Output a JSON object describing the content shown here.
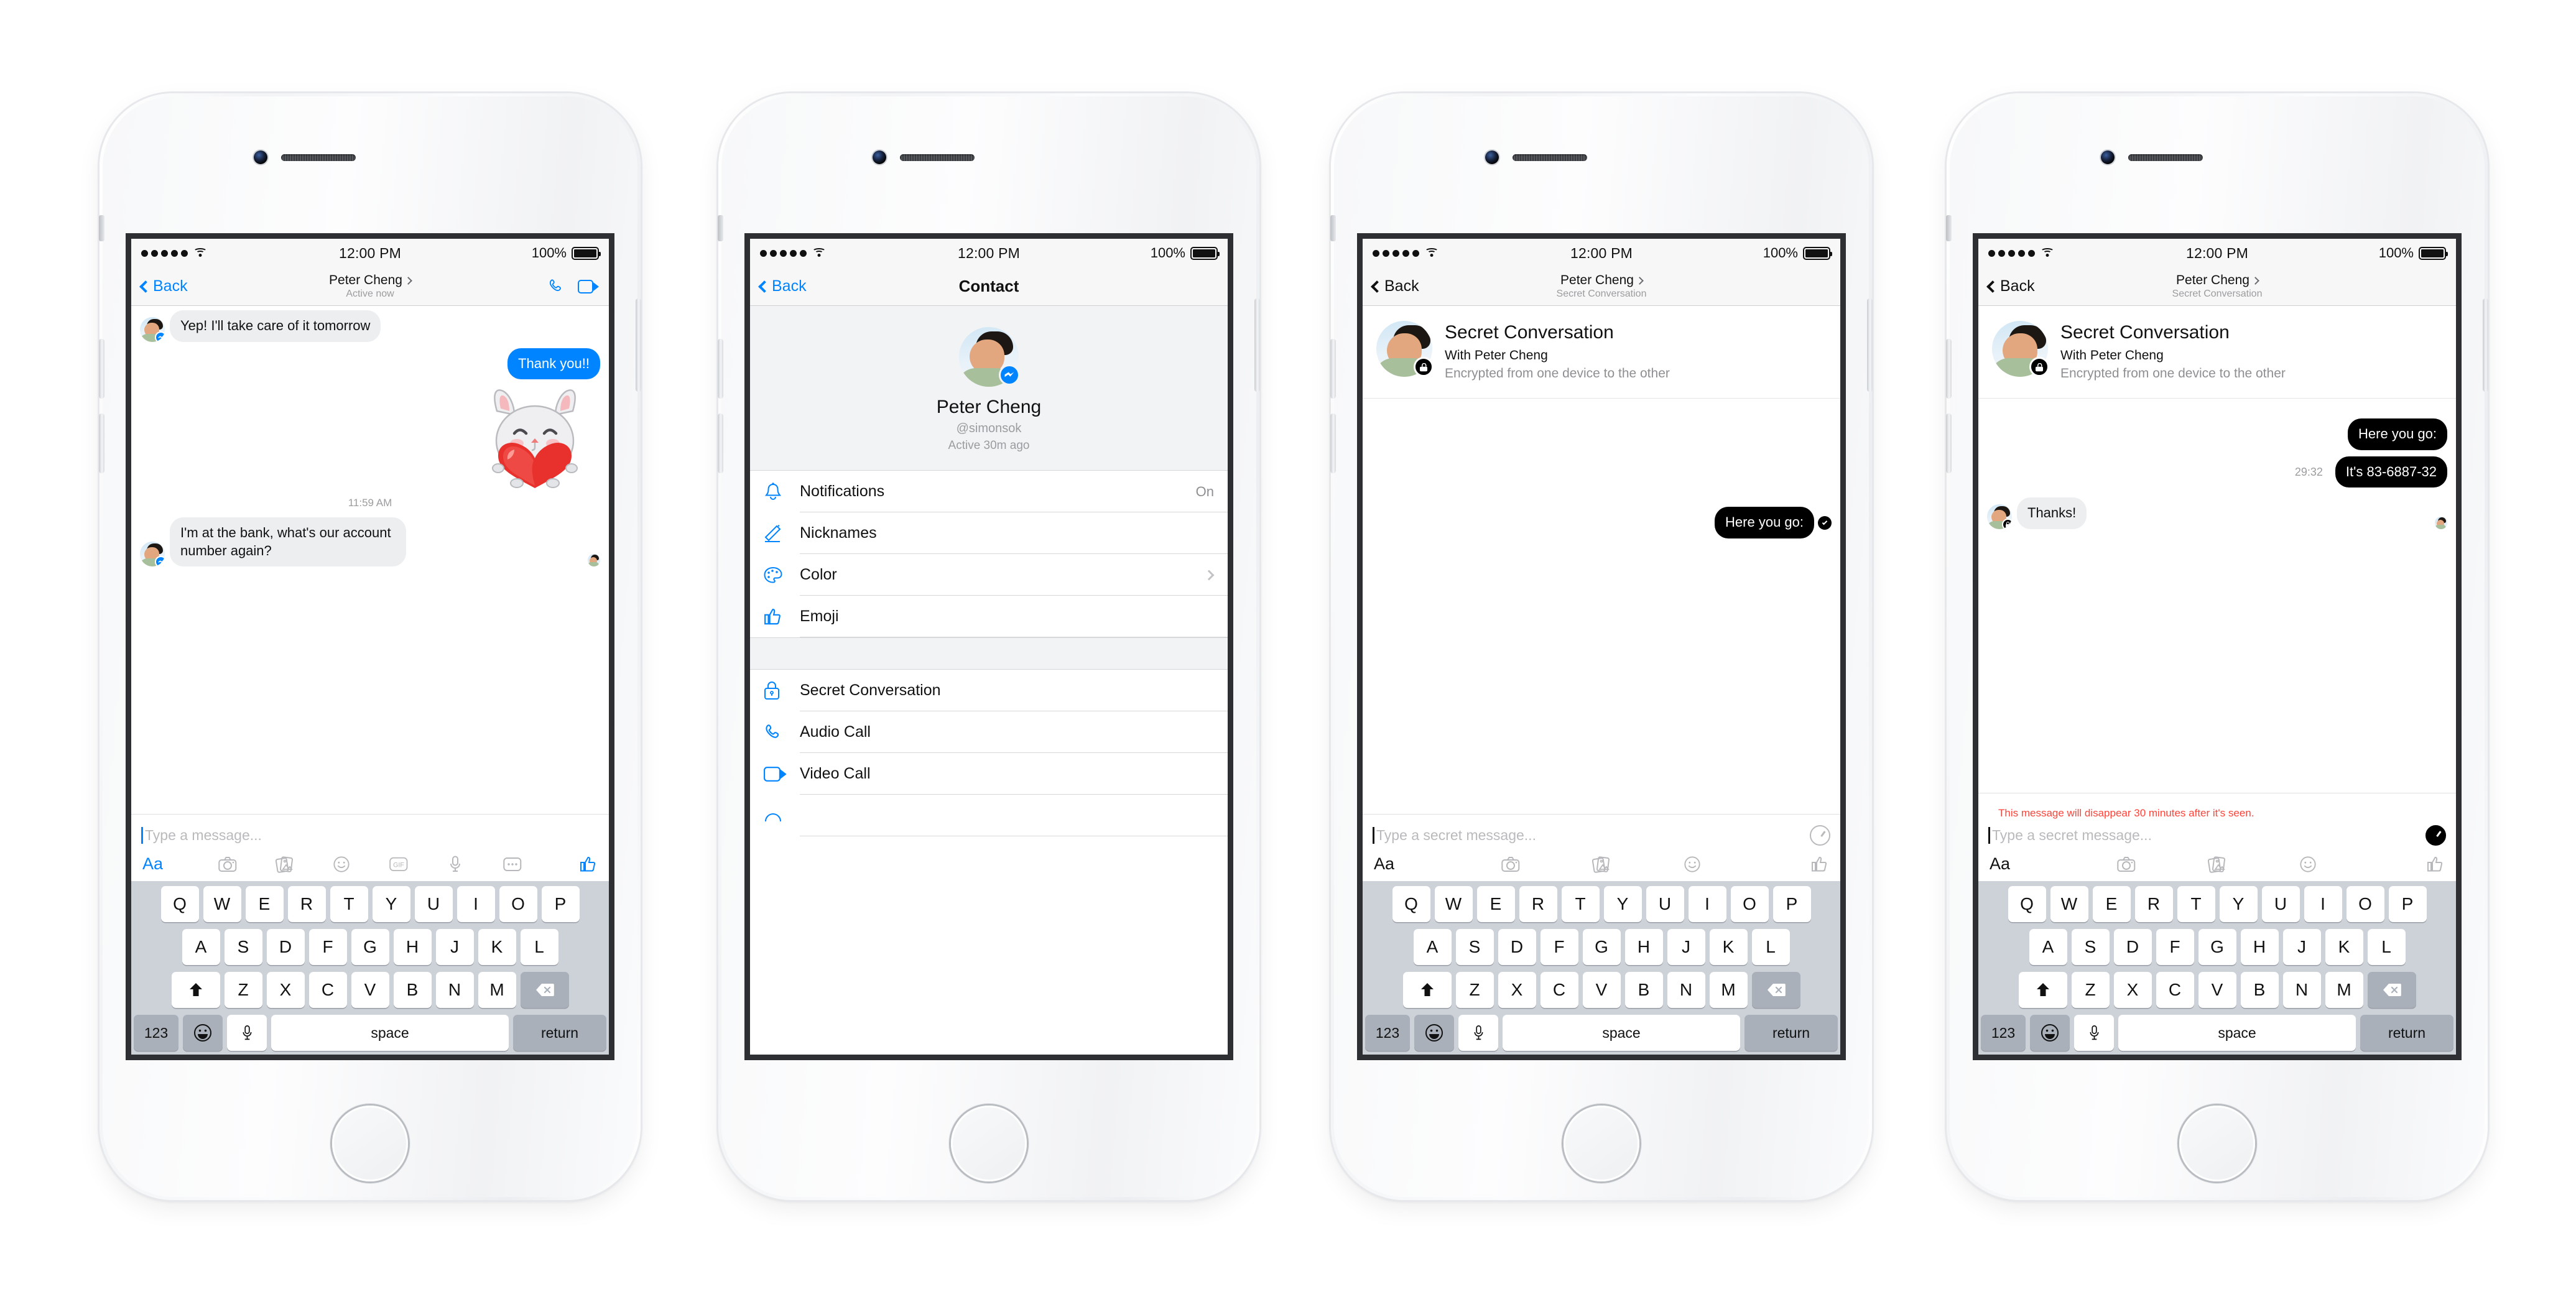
{
  "status_bar": {
    "time": "12:00 PM",
    "battery_pct": "100%",
    "signal_dots": 5
  },
  "colors": {
    "accent_blue": "#0084ff",
    "secret_black": "#000000",
    "warning_red": "#ff4338",
    "keyboard_bg": "#cdd2d9"
  },
  "keyboard": {
    "row1": [
      "Q",
      "W",
      "E",
      "R",
      "T",
      "Y",
      "U",
      "I",
      "O",
      "P"
    ],
    "row2": [
      "A",
      "S",
      "D",
      "F",
      "G",
      "H",
      "J",
      "K",
      "L"
    ],
    "row3": [
      "Z",
      "X",
      "C",
      "V",
      "B",
      "N",
      "M"
    ],
    "num_key": "123",
    "space_key": "space",
    "return_key": "return",
    "shift_icon": "shift-icon",
    "delete_icon": "delete-icon",
    "emoji_icon": "emoji-icon",
    "mic_icon": "microphone-icon"
  },
  "phone1": {
    "nav": {
      "back": "Back",
      "title": "Peter Cheng",
      "subtitle": "Active now",
      "audio_icon": "phone-icon",
      "video_icon": "video-camera-icon"
    },
    "messages": [
      {
        "side": "in",
        "text": "Yep! I'll take care of it tomorrow"
      },
      {
        "side": "out",
        "text": "Thank you!!"
      },
      {
        "side": "out",
        "text": "",
        "type": "sticker",
        "sticker": "bunny-hugging-heart-sticker"
      },
      {
        "type": "timestamp",
        "text": "11:59 AM"
      },
      {
        "side": "in",
        "text": "I'm at the bank, what's our account number again?"
      }
    ],
    "composer": {
      "placeholder": "Type a message...",
      "actions": [
        "Aa",
        "camera-icon",
        "photos-icon",
        "emoji-icon",
        "gif-icon",
        "microphone-icon",
        "more-icon",
        "thumbs-up-icon"
      ]
    }
  },
  "phone2": {
    "nav": {
      "back": "Back",
      "title": "Contact"
    },
    "hero": {
      "name": "Peter Cheng",
      "handle": "@simonsok",
      "active": "Active 30m ago",
      "badge": "messenger-badge"
    },
    "items": [
      {
        "icon": "bell-icon",
        "label": "Notifications",
        "value": "On",
        "chevron": false
      },
      {
        "icon": "pencil-icon",
        "label": "Nicknames",
        "value": "",
        "chevron": false
      },
      {
        "icon": "palette-icon",
        "label": "Color",
        "value": "",
        "chevron": true
      },
      {
        "icon": "thumbs-up-icon",
        "label": "Emoji",
        "value": "",
        "chevron": false
      }
    ],
    "items2": [
      {
        "icon": "lock-icon",
        "label": "Secret Conversation",
        "value": "",
        "chevron": false
      },
      {
        "icon": "phone-icon",
        "label": "Audio Call",
        "value": "",
        "chevron": false
      },
      {
        "icon": "video-camera-icon",
        "label": "Video Call",
        "value": "",
        "chevron": false
      }
    ]
  },
  "phone3": {
    "nav": {
      "back": "Back",
      "title": "Peter Cheng",
      "subtitle": "Secret Conversation"
    },
    "hero": {
      "title": "Secret Conversation",
      "with": "With Peter Cheng",
      "desc": "Encrypted from one device to the other",
      "badge": "lock-badge"
    },
    "messages": [
      {
        "side": "out",
        "text": "Here you go:",
        "seen": true
      }
    ],
    "composer": {
      "placeholder": "Type a secret message...",
      "timer_icon": "timer-icon",
      "actions": [
        "Aa",
        "camera-icon",
        "photos-icon",
        "emoji-icon",
        "thumbs-up-icon"
      ]
    }
  },
  "phone4": {
    "nav": {
      "back": "Back",
      "title": "Peter Cheng",
      "subtitle": "Secret Conversation"
    },
    "hero": {
      "title": "Secret Conversation",
      "with": "With Peter Cheng",
      "desc": "Encrypted from one device to the other",
      "badge": "lock-badge"
    },
    "messages": [
      {
        "side": "out",
        "text": "Here you go:"
      },
      {
        "side": "out",
        "text": "It's 83-6887-32",
        "ttl": "29:32"
      },
      {
        "side": "in",
        "text": "Thanks!"
      }
    ],
    "warning": "This message will disappear 30 minutes after it's seen.",
    "composer": {
      "placeholder": "Type a secret message...",
      "timer_icon": "timer-icon-active",
      "actions": [
        "Aa",
        "camera-icon",
        "photos-icon",
        "emoji-icon",
        "thumbs-up-icon"
      ]
    }
  }
}
